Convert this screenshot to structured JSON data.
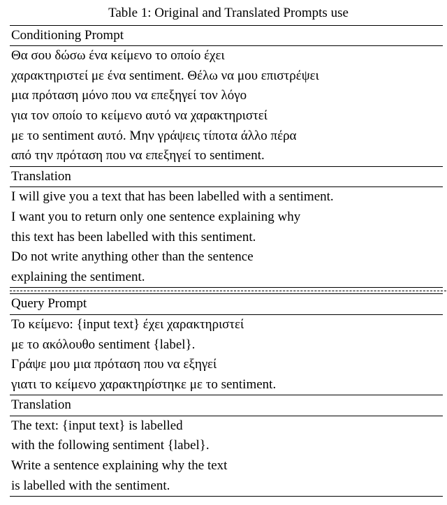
{
  "caption": "Table 1: Original and Translated Prompts use",
  "section1": {
    "header": "Conditioning Prompt",
    "greek": [
      "Θα σου δώσω ένα κείμενο το οποίο έχει",
      "χαρακτηριστεί με ένα sentiment. Θέλω να μου επιστρέψει",
      "μια πρόταση μόνο που να επεξηγεί τον λόγο",
      "για τον οποίο το κείμενο αυτό να χαρακτηριστεί",
      "με το sentiment αυτό. Μην γράψεις τίποτα άλλο πέρα",
      "από την πρόταση που να επεξηγεί το sentiment."
    ],
    "trans_header": "Translation",
    "trans": [
      "I will give you a text that has been labelled with a sentiment.",
      "I want you to return only one sentence explaining why",
      "this text has been labelled with this sentiment.",
      "Do not write anything other than the sentence",
      "explaining the sentiment."
    ]
  },
  "section2": {
    "header": "Query Prompt",
    "greek": [
      "Το κείμενο: {input text} έχει χαρακτηριστεί",
      "με το ακόλουθο sentiment {label}.",
      "Γράψε μου μια πρόταση που να εξηγεί",
      "γιατι το κείμενο χαρακτηρίστηκε με το sentiment."
    ],
    "trans_header": "Translation",
    "trans": [
      "The text: {input text} is labelled",
      "with the following sentiment {label}.",
      "Write a sentence explaining why the text",
      "is labelled with the sentiment."
    ]
  }
}
